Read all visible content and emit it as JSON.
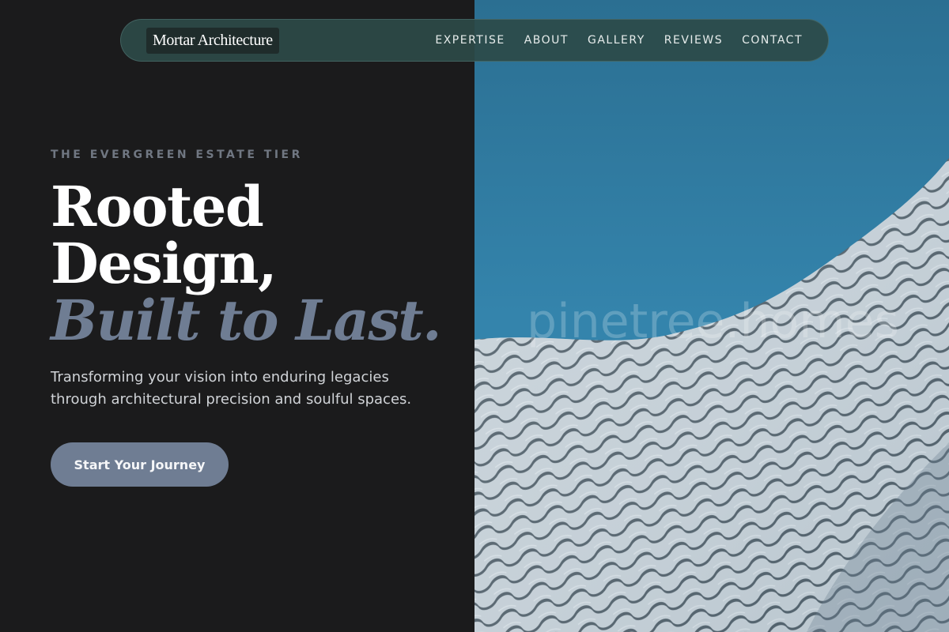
{
  "brand": {
    "logo_text": "Mortar Architecture"
  },
  "nav": {
    "links": [
      {
        "label": "EXPERTISE"
      },
      {
        "label": "ABOUT"
      },
      {
        "label": "GALLERY"
      },
      {
        "label": "REVIEWS"
      },
      {
        "label": "CONTACT"
      }
    ]
  },
  "hero": {
    "eyebrow": "THE EVERGREEN ESTATE TIER",
    "headline_line1": "Rooted",
    "headline_line2": "Design,",
    "headline_line3": "Built to Last.",
    "subtext": "Transforming your vision into enduring legacies through architectural precision and soulful spaces.",
    "cta_label": "Start Your Journey",
    "image_watermark": "pinetree.homes",
    "image_subject": "perforated-metal-facade-against-blue-sky"
  },
  "colors": {
    "background": "#1b1b1c",
    "navbar": "#2c4a48",
    "accent": "#6f7d93",
    "sky": "#3583aa",
    "text_primary": "#ffffff",
    "text_muted": "#707782"
  }
}
